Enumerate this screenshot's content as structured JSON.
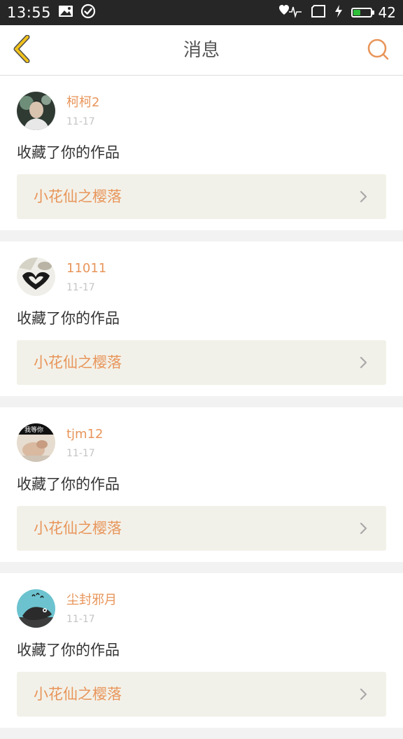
{
  "status_bar": {
    "time": "13:55",
    "battery_level": "42",
    "battery_fraction": 0.42,
    "icons": [
      "gallery-icon",
      "check-circle-icon",
      "wifi-heart-icon",
      "sim-icon",
      "charging-icon",
      "battery-icon"
    ]
  },
  "header": {
    "title": "消息",
    "back_icon": "chevron-left-icon",
    "search_icon": "search-icon"
  },
  "colors": {
    "accent": "#e8955a",
    "back_icon": "#f2c21b",
    "text_primary": "#333333",
    "text_muted": "#c4c4c4",
    "work_card_bg": "#f2f1e9",
    "background": "#f2f2f2"
  },
  "messages": [
    {
      "username": "柯柯2",
      "date": "11-17",
      "action": "收藏了你的作品",
      "work_title": "小花仙之樱落",
      "avatar": "avatar-portrait"
    },
    {
      "username": "11011",
      "date": "11-17",
      "action": "收藏了你的作品",
      "work_title": "小花仙之樱落",
      "avatar": "avatar-heart"
    },
    {
      "username": "tjm12",
      "date": "11-17",
      "action": "收藏了你的作品",
      "work_title": "小花仙之樱落",
      "avatar": "avatar-photo",
      "avatar_text": "F 我等你"
    },
    {
      "username": "尘封邪月",
      "date": "11-17",
      "action": "收藏了你的作品",
      "work_title": "小花仙之樱落",
      "avatar": "avatar-cartoon"
    }
  ]
}
